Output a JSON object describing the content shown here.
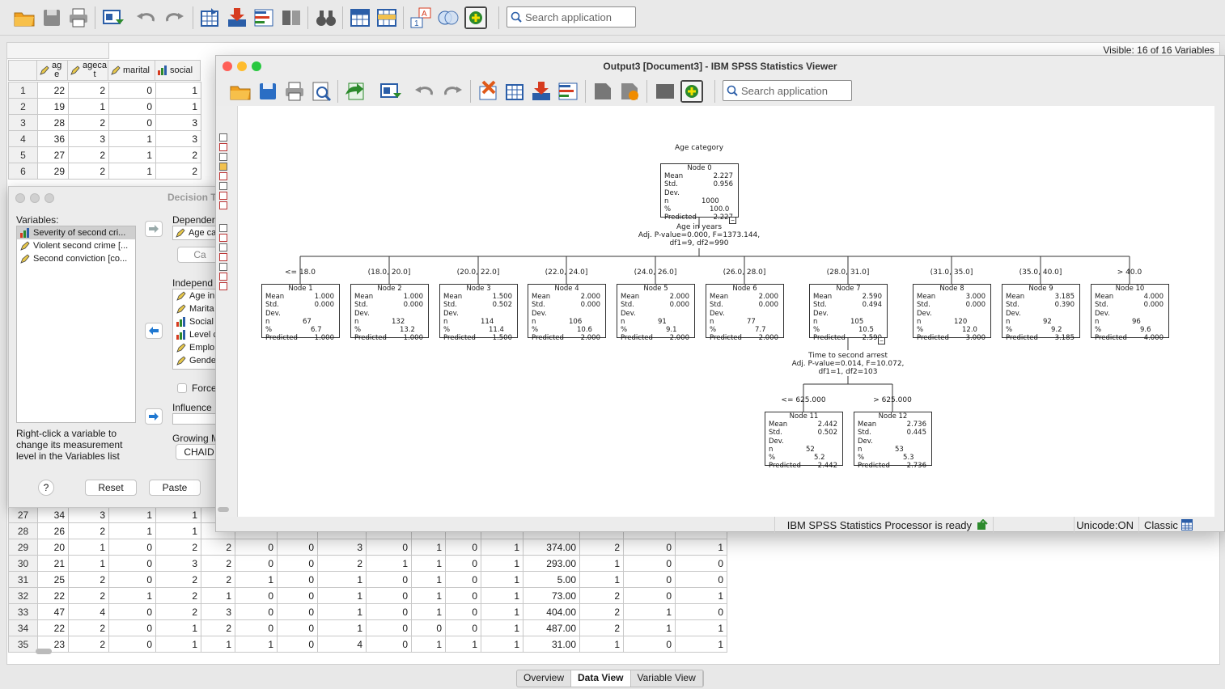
{
  "main": {
    "search_placeholder": "Search application",
    "visible_label": "Visible: 16 of 16 Variables",
    "columns": [
      "ag\ne",
      "ageca\nt",
      "marital",
      "social"
    ],
    "top_rows": [
      {
        "n": "1",
        "c": [
          "22",
          "2",
          "0",
          "1"
        ]
      },
      {
        "n": "2",
        "c": [
          "19",
          "1",
          "0",
          "1"
        ]
      },
      {
        "n": "3",
        "c": [
          "28",
          "2",
          "0",
          "3"
        ]
      },
      {
        "n": "4",
        "c": [
          "36",
          "3",
          "1",
          "3"
        ]
      },
      {
        "n": "5",
        "c": [
          "27",
          "2",
          "1",
          "2"
        ]
      },
      {
        "n": "6",
        "c": [
          "29",
          "2",
          "1",
          "2"
        ]
      }
    ],
    "bottom_rows": [
      {
        "n": "27",
        "c": [
          "34",
          "3",
          "1",
          "1",
          "",
          "",
          "",
          "",
          "",
          "",
          "",
          "",
          "",
          "",
          "",
          ""
        ]
      },
      {
        "n": "28",
        "c": [
          "26",
          "2",
          "1",
          "1",
          "",
          "",
          "",
          "",
          "",
          "",
          "",
          "",
          "",
          "",
          "",
          ""
        ]
      },
      {
        "n": "29",
        "c": [
          "20",
          "1",
          "0",
          "2",
          "2",
          "0",
          "0",
          "3",
          "0",
          "1",
          "0",
          "1",
          "374.00",
          "2",
          "0",
          "1"
        ]
      },
      {
        "n": "30",
        "c": [
          "21",
          "1",
          "0",
          "3",
          "2",
          "0",
          "0",
          "2",
          "1",
          "1",
          "0",
          "1",
          "293.00",
          "1",
          "0",
          "0"
        ]
      },
      {
        "n": "31",
        "c": [
          "25",
          "2",
          "0",
          "2",
          "2",
          "1",
          "0",
          "1",
          "0",
          "1",
          "0",
          "1",
          "5.00",
          "1",
          "0",
          "0"
        ]
      },
      {
        "n": "32",
        "c": [
          "22",
          "2",
          "1",
          "2",
          "1",
          "0",
          "0",
          "1",
          "0",
          "1",
          "0",
          "1",
          "73.00",
          "2",
          "0",
          "1"
        ]
      },
      {
        "n": "33",
        "c": [
          "47",
          "4",
          "0",
          "2",
          "3",
          "0",
          "0",
          "1",
          "0",
          "1",
          "0",
          "1",
          "404.00",
          "2",
          "1",
          "0"
        ]
      },
      {
        "n": "34",
        "c": [
          "22",
          "2",
          "0",
          "1",
          "2",
          "0",
          "0",
          "1",
          "0",
          "0",
          "0",
          "1",
          "487.00",
          "2",
          "1",
          "1"
        ]
      },
      {
        "n": "35",
        "c": [
          "23",
          "2",
          "0",
          "1",
          "1",
          "1",
          "0",
          "4",
          "0",
          "1",
          "1",
          "1",
          "31.00",
          "1",
          "0",
          "1"
        ]
      }
    ],
    "tabs": [
      "Overview",
      "Data View",
      "Variable View"
    ]
  },
  "dialog": {
    "title": "Decision T",
    "variables_label": "Variables:",
    "variables": [
      "Severity of second cri...",
      "Violent second crime [...",
      "Second conviction [co..."
    ],
    "dependent_label": "Depender",
    "dependent_value": "Age ca",
    "categories_button": "Ca",
    "independent_label": "Independ",
    "independent_vars": [
      "Age in",
      "Marita",
      "Social",
      "Level c",
      "Emplo",
      "Gende"
    ],
    "force_label": "Force",
    "influence_label": "Influence",
    "growing_label": "Growing M",
    "growing_value": "CHAID",
    "hint": "Right-click a variable to change its measurement level in the Variables list",
    "help": "?",
    "reset": "Reset",
    "paste": "Paste"
  },
  "viewer": {
    "title": "Output3 [Document3] - IBM SPSS Statistics Viewer",
    "search_placeholder": "Search application",
    "status": "IBM SPSS Statistics Processor is ready",
    "unicode": "Unicode:ON",
    "mode": "Classic",
    "tree": {
      "root_title": "Age category",
      "root": {
        "name": "Node 0",
        "mean": "2.227",
        "sd": "0.956",
        "n": "1000",
        "pct": "100.0",
        "pred": "2.227"
      },
      "split1": [
        "Age in years",
        "Adj. P-value=0.000, F=1373.144,",
        "df1=9, df2=990"
      ],
      "branches": [
        "<= 18.0",
        "(18.0, 20.0]",
        "(20.0, 22.0]",
        "(22.0, 24.0]",
        "(24.0, 26.0]",
        "(26.0, 28.0]",
        "(28.0, 31.0]",
        "(31.0, 35.0]",
        "(35.0, 40.0]",
        "> 40.0"
      ],
      "nodes": [
        {
          "name": "Node 1",
          "mean": "1.000",
          "sd": "0.000",
          "n": "67",
          "pct": "6.7",
          "pred": "1.000"
        },
        {
          "name": "Node 2",
          "mean": "1.000",
          "sd": "0.000",
          "n": "132",
          "pct": "13.2",
          "pred": "1.000"
        },
        {
          "name": "Node 3",
          "mean": "1.500",
          "sd": "0.502",
          "n": "114",
          "pct": "11.4",
          "pred": "1.500"
        },
        {
          "name": "Node 4",
          "mean": "2.000",
          "sd": "0.000",
          "n": "106",
          "pct": "10.6",
          "pred": "2.000"
        },
        {
          "name": "Node 5",
          "mean": "2.000",
          "sd": "0.000",
          "n": "91",
          "pct": "9.1",
          "pred": "2.000"
        },
        {
          "name": "Node 6",
          "mean": "2.000",
          "sd": "0.000",
          "n": "77",
          "pct": "7.7",
          "pred": "2.000"
        },
        {
          "name": "Node 7",
          "mean": "2.590",
          "sd": "0.494",
          "n": "105",
          "pct": "10.5",
          "pred": "2.590"
        },
        {
          "name": "Node 8",
          "mean": "3.000",
          "sd": "0.000",
          "n": "120",
          "pct": "12.0",
          "pred": "3.000"
        },
        {
          "name": "Node 9",
          "mean": "3.185",
          "sd": "0.390",
          "n": "92",
          "pct": "9.2",
          "pred": "3.185"
        },
        {
          "name": "Node 10",
          "mean": "4.000",
          "sd": "0.000",
          "n": "96",
          "pct": "9.6",
          "pred": "4.000"
        }
      ],
      "split2": [
        "Time to second arrest",
        "Adj. P-value=0.014, F=10.072,",
        "df1=1, df2=103"
      ],
      "branches2": [
        "<= 625.000",
        "> 625.000"
      ],
      "nodes2": [
        {
          "name": "Node 11",
          "mean": "2.442",
          "sd": "0.502",
          "n": "52",
          "pct": "5.2",
          "pred": "2.442"
        },
        {
          "name": "Node 12",
          "mean": "2.736",
          "sd": "0.445",
          "n": "53",
          "pct": "5.3",
          "pred": "2.736"
        }
      ],
      "labels": {
        "mean": "Mean",
        "sd": "Std. Dev.",
        "n": "n",
        "pct": "%",
        "pred": "Predicted"
      }
    }
  }
}
